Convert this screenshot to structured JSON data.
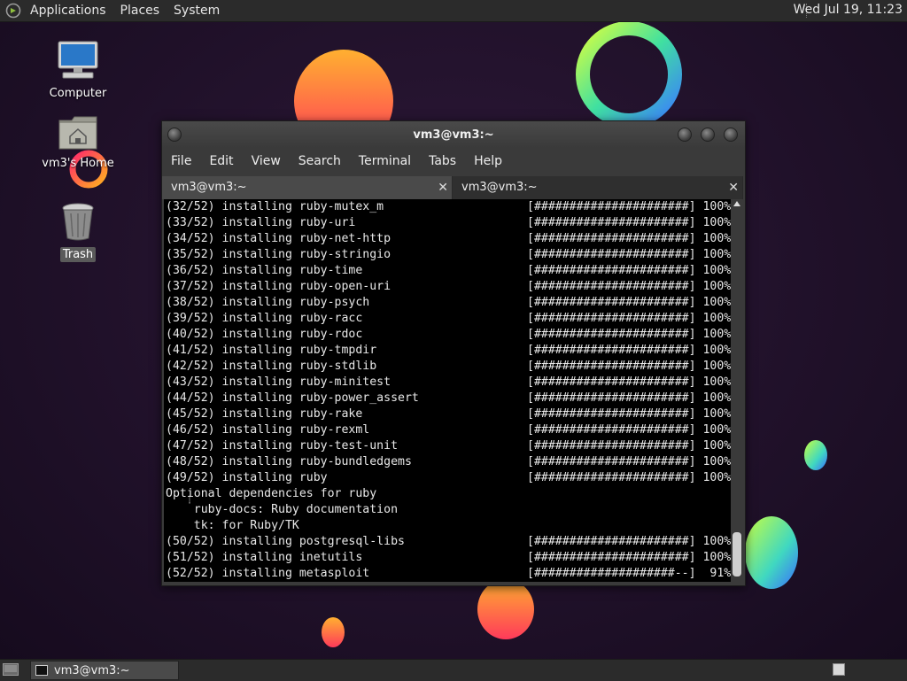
{
  "top_panel": {
    "menus": [
      "Applications",
      "Places",
      "System"
    ],
    "clock": "Wed Jul 19, 11:23"
  },
  "desktop": {
    "icons": [
      {
        "label": "Computer",
        "icon": "computer-icon"
      },
      {
        "label": "vm3's Home",
        "icon": "home-folder-icon"
      },
      {
        "label": "Trash",
        "icon": "trash-icon"
      }
    ]
  },
  "window": {
    "title": "vm3@vm3:~",
    "menu": [
      "File",
      "Edit",
      "View",
      "Search",
      "Terminal",
      "Tabs",
      "Help"
    ],
    "tabs": [
      {
        "label": "vm3@vm3:~",
        "active": true
      },
      {
        "label": "vm3@vm3:~",
        "active": false
      }
    ]
  },
  "terminal": {
    "lines": [
      {
        "text": "(32/52) installing ruby-mutex_m",
        "progress": "[######################] 100%"
      },
      {
        "text": "(33/52) installing ruby-uri",
        "progress": "[######################] 100%"
      },
      {
        "text": "(34/52) installing ruby-net-http",
        "progress": "[######################] 100%"
      },
      {
        "text": "(35/52) installing ruby-stringio",
        "progress": "[######################] 100%"
      },
      {
        "text": "(36/52) installing ruby-time",
        "progress": "[######################] 100%"
      },
      {
        "text": "(37/52) installing ruby-open-uri",
        "progress": "[######################] 100%"
      },
      {
        "text": "(38/52) installing ruby-psych",
        "progress": "[######################] 100%"
      },
      {
        "text": "(39/52) installing ruby-racc",
        "progress": "[######################] 100%"
      },
      {
        "text": "(40/52) installing ruby-rdoc",
        "progress": "[######################] 100%"
      },
      {
        "text": "(41/52) installing ruby-tmpdir",
        "progress": "[######################] 100%"
      },
      {
        "text": "(42/52) installing ruby-stdlib",
        "progress": "[######################] 100%"
      },
      {
        "text": "(43/52) installing ruby-minitest",
        "progress": "[######################] 100%"
      },
      {
        "text": "(44/52) installing ruby-power_assert",
        "progress": "[######################] 100%"
      },
      {
        "text": "(45/52) installing ruby-rake",
        "progress": "[######################] 100%"
      },
      {
        "text": "(46/52) installing ruby-rexml",
        "progress": "[######################] 100%"
      },
      {
        "text": "(47/52) installing ruby-test-unit",
        "progress": "[######################] 100%"
      },
      {
        "text": "(48/52) installing ruby-bundledgems",
        "progress": "[######################] 100%"
      },
      {
        "text": "(49/52) installing ruby",
        "progress": "[######################] 100%"
      },
      {
        "text": "Optional dependencies for ruby",
        "progress": ""
      },
      {
        "text": "    ruby-docs: Ruby documentation",
        "progress": ""
      },
      {
        "text": "    tk: for Ruby/TK",
        "progress": ""
      },
      {
        "text": "(50/52) installing postgresql-libs",
        "progress": "[######################] 100%"
      },
      {
        "text": "(51/52) installing inetutils",
        "progress": "[######################] 100%"
      },
      {
        "text": "(52/52) installing metasploit",
        "progress": "[####################--]  91%"
      }
    ]
  },
  "bottom_panel": {
    "task_label": "vm3@vm3:~"
  },
  "colors": {
    "panel_bg": "#2b2b2b",
    "terminal_bg": "#000000",
    "terminal_fg": "#e8e8e8",
    "desktop_bg": "#1d0f26"
  }
}
